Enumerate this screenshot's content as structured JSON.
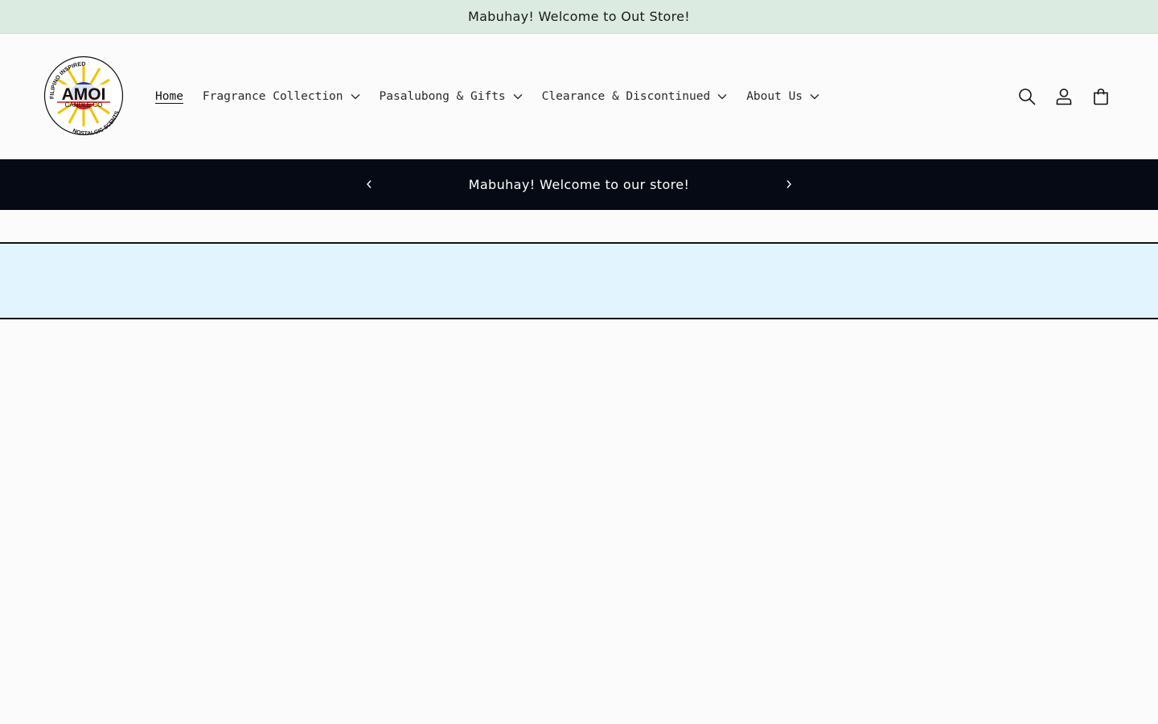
{
  "top_bar": {
    "text": "Mabuhay! Welcome to Out Store!"
  },
  "logo": {
    "top_text": "FILIPINO INSPIRED",
    "name": "AMOI",
    "subname": "CANDLE CO",
    "bottom_text": "NOSTALGIC SCENTS"
  },
  "nav": {
    "items": [
      {
        "label": "Home",
        "active": true,
        "has_dropdown": false
      },
      {
        "label": "Fragrance Collection",
        "active": false,
        "has_dropdown": true
      },
      {
        "label": "Pasalubong & Gifts",
        "active": false,
        "has_dropdown": true
      },
      {
        "label": "Clearance & Discontinued",
        "active": false,
        "has_dropdown": true
      },
      {
        "label": "About Us",
        "active": false,
        "has_dropdown": true
      }
    ]
  },
  "header_icons": [
    "search-icon",
    "account-icon",
    "cart-icon"
  ],
  "announcement": {
    "text": "Mabuhay! Welcome to our store!"
  },
  "colors": {
    "top_bar_bg": "#dcebe1",
    "announcement_bg": "#050a14",
    "banner_bg": "#e2f5ff",
    "page_bg": "#fbfbfb"
  }
}
